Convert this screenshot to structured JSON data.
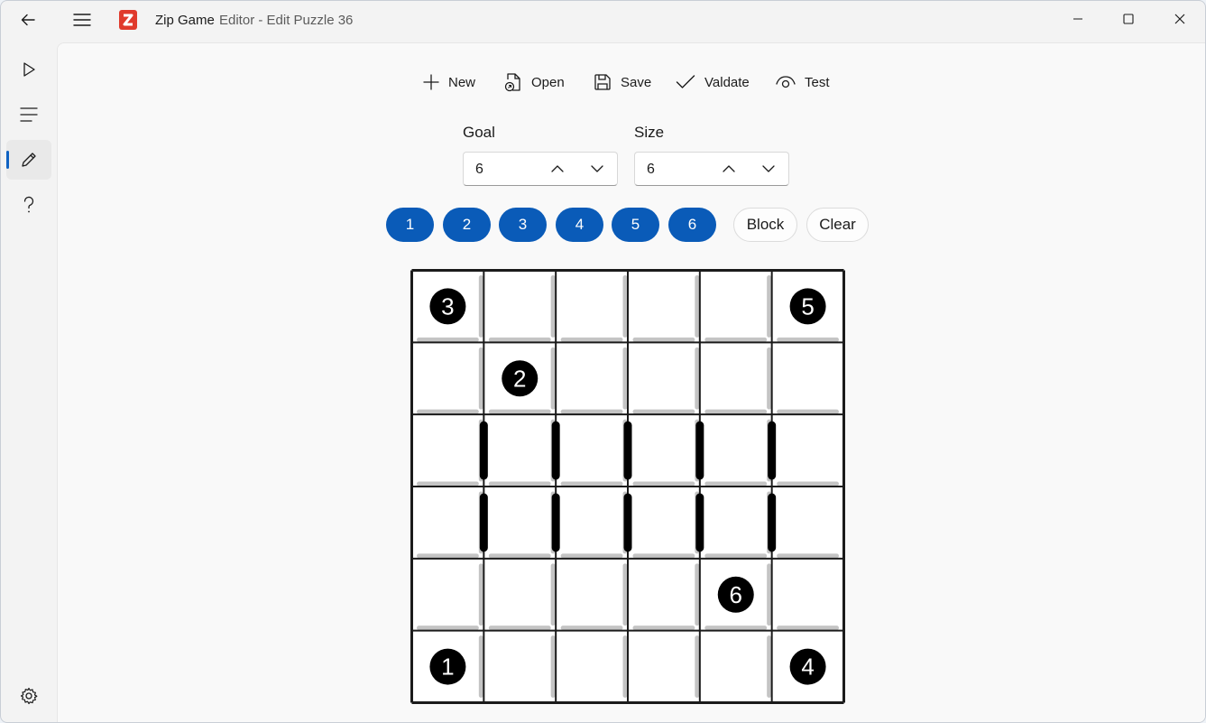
{
  "window": {
    "app_name": "Zip Game",
    "subtitle": "Editor - Edit Puzzle 36"
  },
  "nav": {
    "items": [
      {
        "name": "play",
        "icon": "play-icon"
      },
      {
        "name": "list",
        "icon": "list-icon"
      },
      {
        "name": "edit",
        "icon": "pencil-icon",
        "selected": true
      },
      {
        "name": "help",
        "icon": "question-icon"
      }
    ],
    "settings_icon": "gear-icon",
    "accent": "#0f62c2"
  },
  "toolbar": {
    "new_label": "New",
    "open_label": "Open",
    "save_label": "Save",
    "validate_label": "Valdate",
    "test_label": "Test"
  },
  "fields": {
    "goal": {
      "label": "Goal",
      "value": "6"
    },
    "size": {
      "label": "Size",
      "value": "6"
    }
  },
  "palette": {
    "numbers": [
      "1",
      "2",
      "3",
      "4",
      "5",
      "6"
    ],
    "block_label": "Block",
    "clear_label": "Clear",
    "accent": "#0a5bb8"
  },
  "puzzle": {
    "size": 6,
    "cells": [
      {
        "row": 0,
        "col": 0,
        "label": "3"
      },
      {
        "row": 0,
        "col": 5,
        "label": "5"
      },
      {
        "row": 1,
        "col": 1,
        "label": "2"
      },
      {
        "row": 4,
        "col": 4,
        "label": "6"
      },
      {
        "row": 5,
        "col": 0,
        "label": "1"
      },
      {
        "row": 5,
        "col": 5,
        "label": "4"
      }
    ],
    "walls": [
      {
        "row": 2,
        "col": 0,
        "side": "right"
      },
      {
        "row": 2,
        "col": 1,
        "side": "right"
      },
      {
        "row": 2,
        "col": 2,
        "side": "right"
      },
      {
        "row": 2,
        "col": 3,
        "side": "right"
      },
      {
        "row": 2,
        "col": 4,
        "side": "right"
      },
      {
        "row": 3,
        "col": 0,
        "side": "right"
      },
      {
        "row": 3,
        "col": 1,
        "side": "right"
      },
      {
        "row": 3,
        "col": 2,
        "side": "right"
      },
      {
        "row": 3,
        "col": 3,
        "side": "right"
      },
      {
        "row": 3,
        "col": 4,
        "side": "right"
      }
    ]
  }
}
